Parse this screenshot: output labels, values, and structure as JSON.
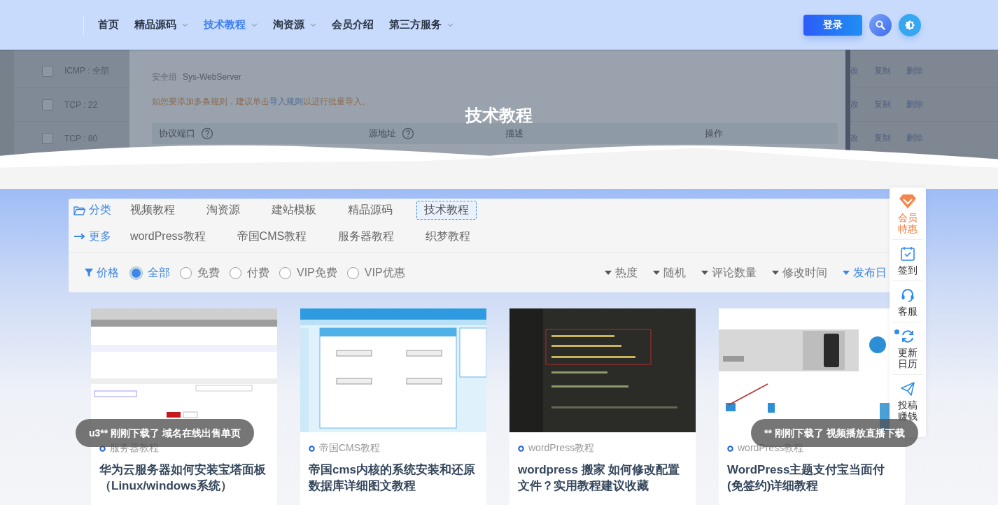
{
  "header": {
    "nav": [
      {
        "label": "首页",
        "dropdown": false,
        "selected": false
      },
      {
        "label": "精品源码",
        "dropdown": true,
        "selected": false
      },
      {
        "label": "技术教程",
        "dropdown": true,
        "selected": true
      },
      {
        "label": "淘资源",
        "dropdown": true,
        "selected": false
      },
      {
        "label": "会员介绍",
        "dropdown": false,
        "selected": false
      },
      {
        "label": "第三方服务",
        "dropdown": true,
        "selected": false
      }
    ],
    "login_button": "登录"
  },
  "hero": {
    "title": "技术教程",
    "background": {
      "rules": [
        {
          "label": "ICMP : 全部",
          "checked": false,
          "actions": [
            "改",
            "复制",
            "删除"
          ]
        },
        {
          "label": "TCP : 22",
          "checked": false,
          "actions": [
            "改",
            "复制",
            "删除"
          ]
        },
        {
          "label": "TCP : 80",
          "checked": false,
          "actions": [
            "改",
            "复制",
            "删除"
          ]
        }
      ],
      "group_label": "安全组",
      "group_name": "Sys-WebServer",
      "notice": {
        "before": "如您要添加多条规则，建议单击",
        "link": "导入规则",
        "after": "以进行批量导入。"
      },
      "columns": [
        {
          "label": "协议端口",
          "help": true
        },
        {
          "label": "源地址",
          "help": true
        },
        {
          "label": "描述",
          "help": false
        },
        {
          "label": "操作",
          "help": false
        }
      ]
    }
  },
  "filters": {
    "category_label": "分类",
    "categories": [
      {
        "label": "视频教程",
        "selected": false
      },
      {
        "label": "淘资源",
        "selected": false
      },
      {
        "label": "建站模板",
        "selected": false
      },
      {
        "label": "精品源码",
        "selected": false
      },
      {
        "label": "技术教程",
        "selected": true
      }
    ],
    "more_label": "更多",
    "more": [
      "wordPress教程",
      "帝国CMS教程",
      "服务器教程",
      "织梦教程"
    ],
    "price_label": "价格",
    "prices": [
      {
        "label": "全部",
        "selected": true
      },
      {
        "label": "免费",
        "selected": false
      },
      {
        "label": "付费",
        "selected": false
      },
      {
        "label": "VIP免费",
        "selected": false
      },
      {
        "label": "VIP优惠",
        "selected": false
      }
    ],
    "sorts": [
      {
        "label": "热度",
        "selected": false
      },
      {
        "label": "随机",
        "selected": false
      },
      {
        "label": "评论数量",
        "selected": false
      },
      {
        "label": "修改时间",
        "selected": false
      },
      {
        "label": "发布日",
        "selected": true
      }
    ]
  },
  "posts": [
    {
      "category": "服务器教程",
      "title": "华为云服务器如何安装宝塔面板（Linux/windows系统）"
    },
    {
      "category": "帝国CMS教程",
      "title": "帝国cms内核的系统安装和还原数据库详细图文教程"
    },
    {
      "category": "wordPress教程",
      "title": "wordpress 搬家 如何修改配置文件？实用教程建议收藏"
    },
    {
      "category": "wordPress教程",
      "title": "WordPress主题支付宝当面付(免签约)详细教程"
    }
  ],
  "side_bar": [
    {
      "kind": "vip",
      "label": "会员特惠",
      "badge": false
    },
    {
      "kind": "checkin",
      "label": "签到",
      "badge": false
    },
    {
      "kind": "service",
      "label": "客服",
      "badge": false
    },
    {
      "kind": "update",
      "label": "更新日历",
      "badge": true
    },
    {
      "kind": "submit",
      "label": "投稿赚钱",
      "badge": false
    }
  ],
  "toasts": [
    {
      "text": "u3** 刚刚下载了 域名在线出售单页"
    },
    {
      "text": "** 刚刚下载了 视频播放直播下载"
    }
  ]
}
